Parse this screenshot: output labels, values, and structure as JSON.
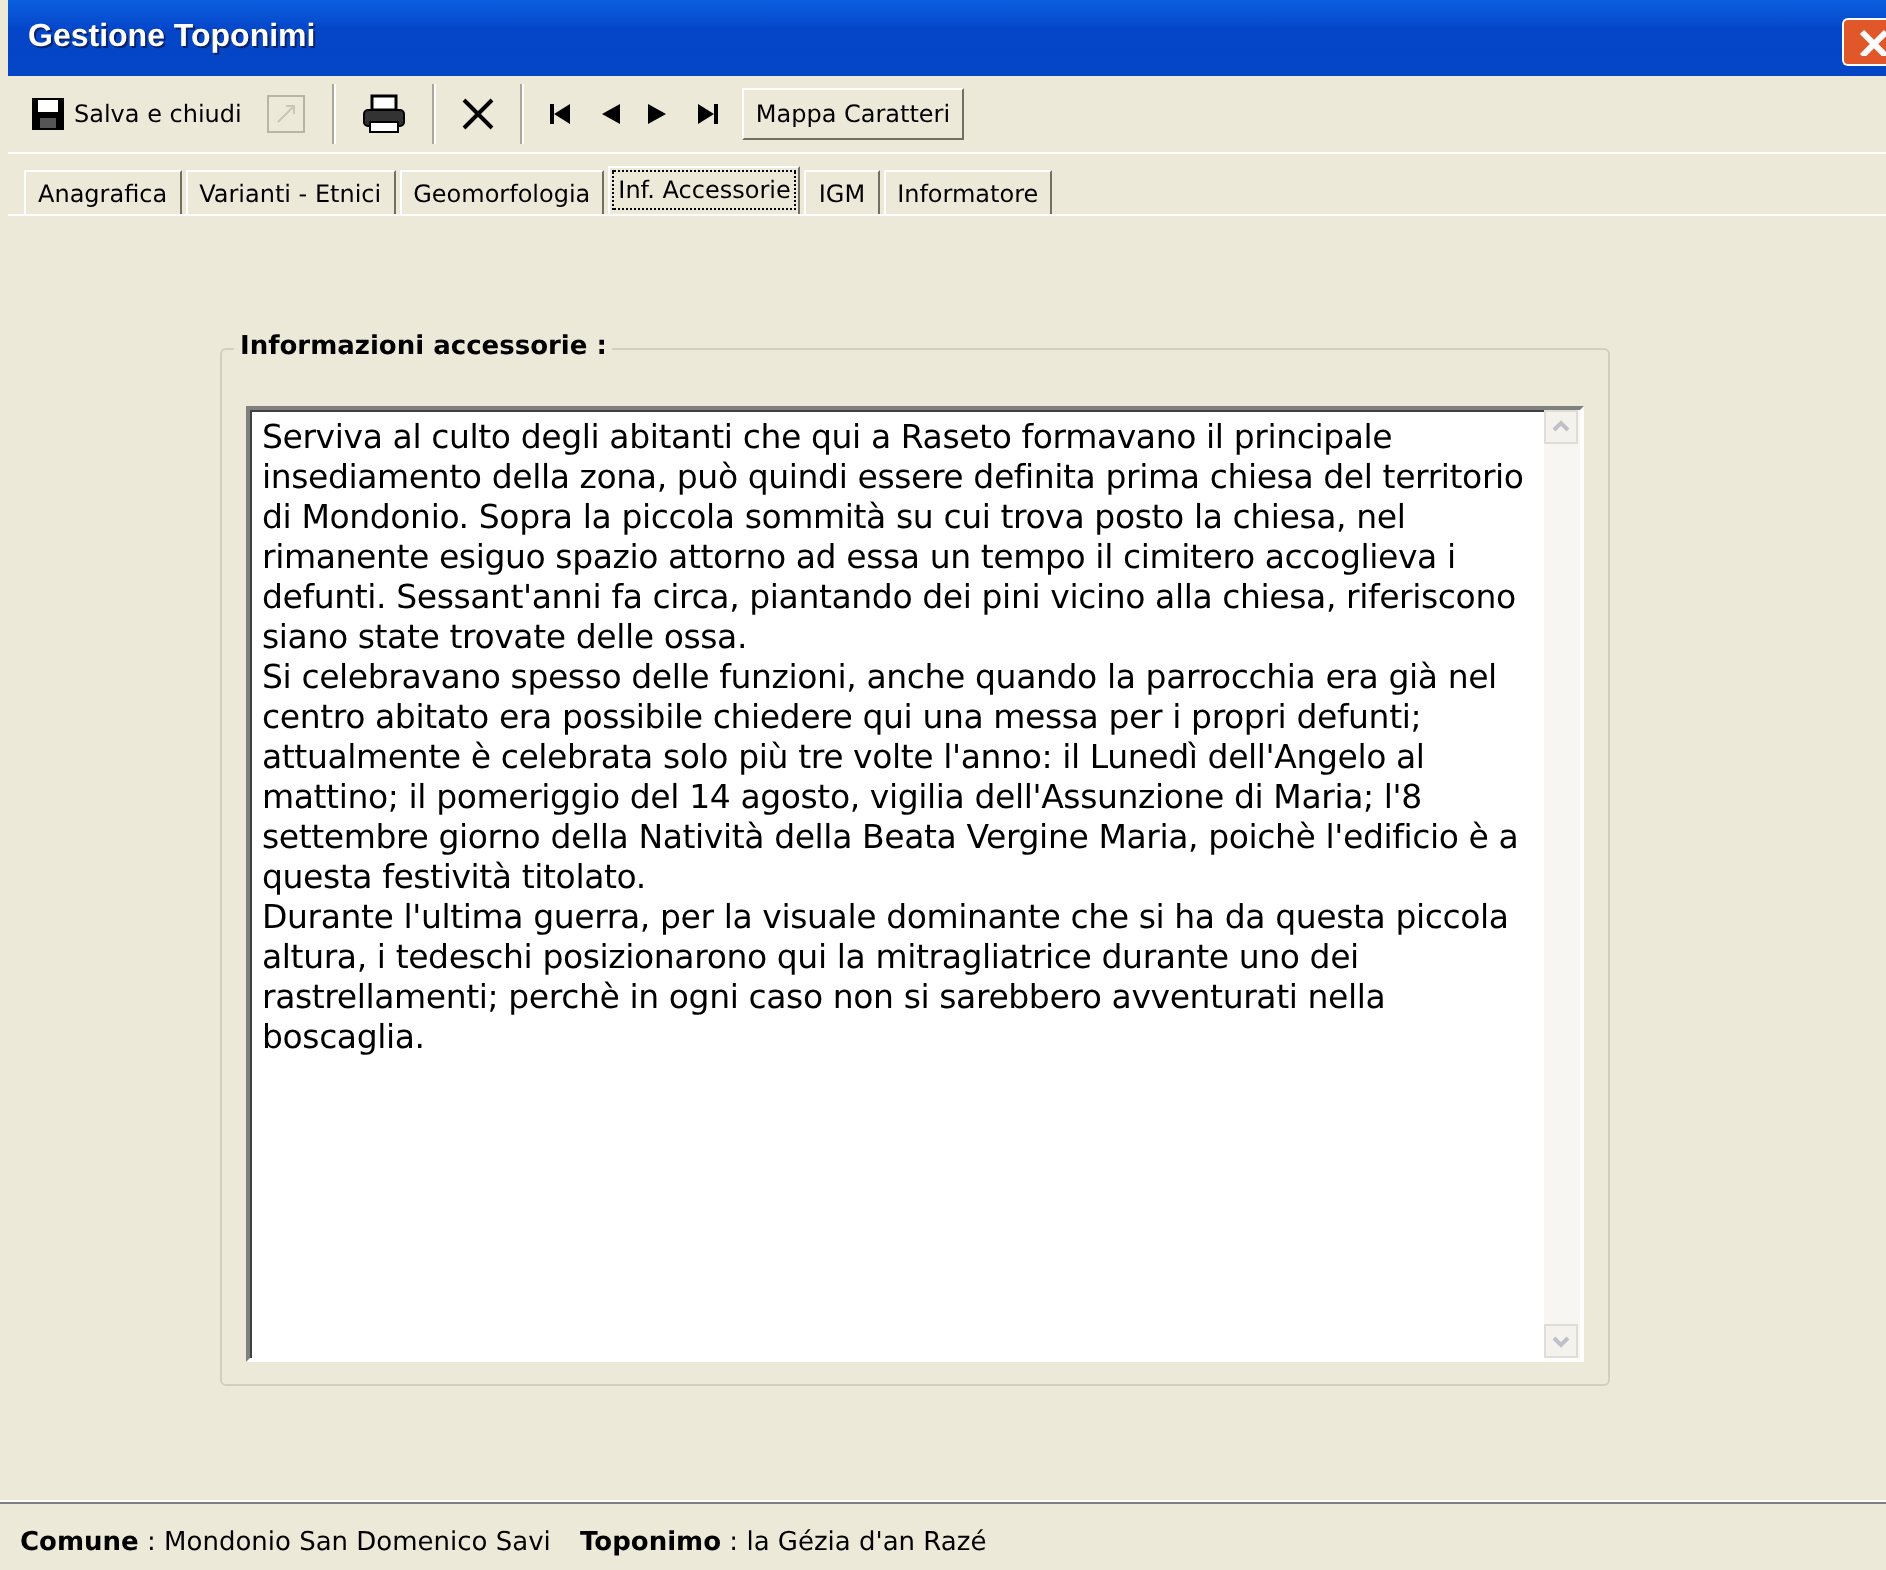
{
  "window": {
    "title": "Gestione Toponimi"
  },
  "toolbar": {
    "save_label": "Salva e chiudi",
    "charmap_label": "Mappa Caratteri"
  },
  "tabs": [
    {
      "label": "Anagrafica",
      "selected": false
    },
    {
      "label": "Varianti - Etnici",
      "selected": false
    },
    {
      "label": "Geomorfologia",
      "selected": false
    },
    {
      "label": "Inf. Accessorie",
      "selected": true
    },
    {
      "label": "IGM",
      "selected": false
    },
    {
      "label": "Informatore",
      "selected": false
    }
  ],
  "group": {
    "title": "Informazioni accessorie :",
    "text": "Serviva al culto degli abitanti che qui a Raseto formavano il principale insediamento della zona, può quindi essere definita prima chiesa del territorio di Mondonio. Sopra la piccola sommità su cui trova posto la chiesa, nel rimanente esiguo spazio attorno ad essa un tempo il cimitero accoglieva i defunti. Sessant'anni fa circa, piantando dei pini vicino alla chiesa, riferiscono siano state trovate delle ossa.\nSi celebravano spesso delle funzioni, anche quando la parrocchia era già nel centro abitato era possibile chiedere qui una messa per i propri defunti; attualmente è celebrata solo più tre volte l'anno: il Lunedì dell'Angelo al mattino; il pomeriggio del 14 agosto, vigilia dell'Assunzione di Maria; l'8 settembre giorno della Natività della Beata Vergine Maria, poichè l'edificio è a questa festività titolato.\nDurante l'ultima guerra, per la visuale dominante che si ha da questa piccola altura, i tedeschi posizionarono qui la mitragliatrice durante uno dei rastrellamenti; perchè in ogni caso non si sarebbero avventurati nella boscaglia."
  },
  "status_bar": {
    "comune_label": "Comune",
    "comune_sep": ":",
    "comune_value": "Mondonio San Domenico Savi",
    "toponimo_label": "Toponimo",
    "toponimo_sep": ":",
    "toponimo_value": "la Gézia d'an Razé"
  }
}
